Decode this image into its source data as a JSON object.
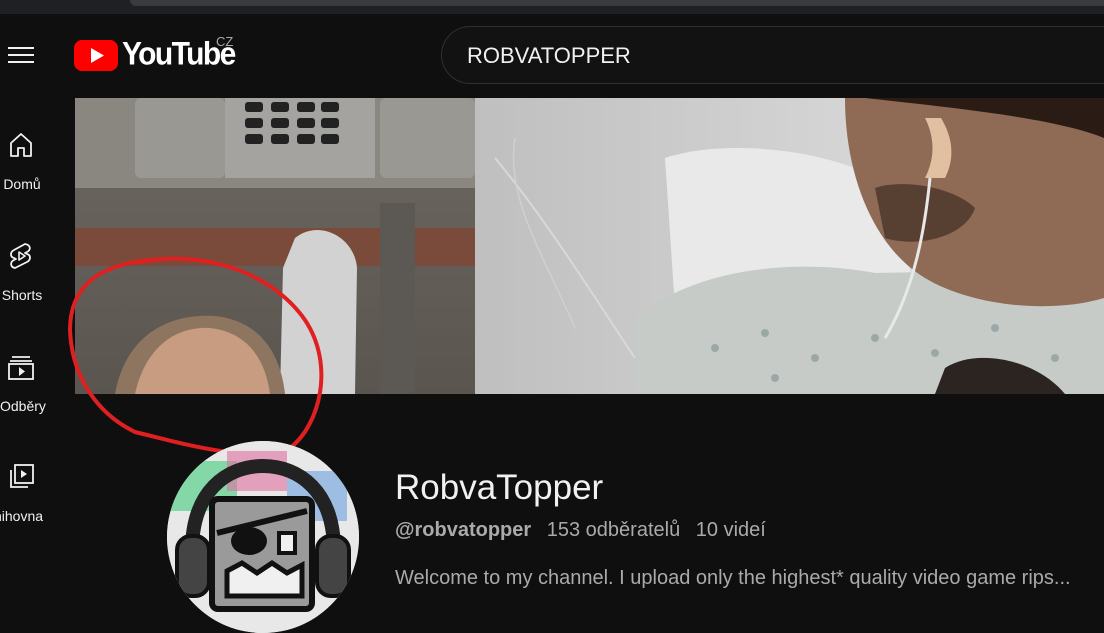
{
  "logo": {
    "text": "YouTube",
    "country": "CZ",
    "brand_color": "#ff0000"
  },
  "search": {
    "value": "ROBVATOPPER"
  },
  "sidebar": {
    "items": [
      {
        "label": "Domů",
        "icon": "home-icon"
      },
      {
        "label": "Shorts",
        "icon": "shorts-icon"
      },
      {
        "label": "Odběry",
        "icon": "subscriptions-icon"
      },
      {
        "label": "nihovna",
        "icon": "library-icon"
      }
    ]
  },
  "channel": {
    "name": "RobvaTopper",
    "handle": "@robvatopper",
    "subscribers": "153 odběratelů",
    "videos": "10 videí",
    "description": "Welcome to my channel. I upload only the highest* quality video game rips..."
  },
  "colors": {
    "background": "#0f0f0f",
    "text": "#f1f1f1",
    "secondary_text": "#aaaaaa",
    "annotation": "#e02020"
  }
}
